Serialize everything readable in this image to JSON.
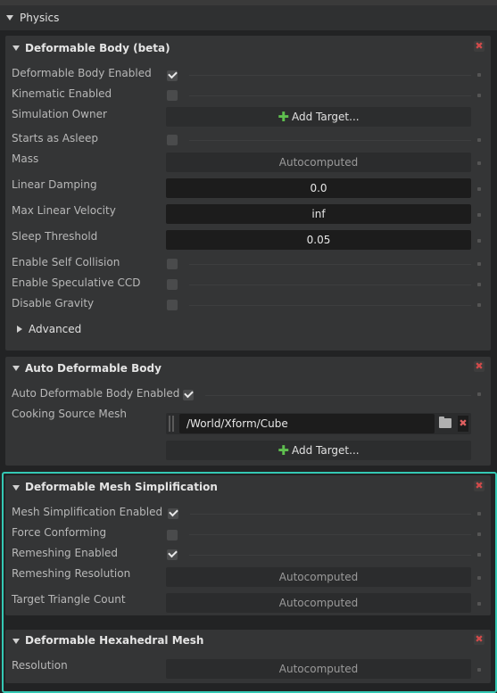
{
  "physics": {
    "title": "Physics"
  },
  "deformable_body": {
    "title": "Deformable Body (beta)",
    "rows": [
      {
        "label": "Deformable Body Enabled",
        "type": "checkbox",
        "checked": true
      },
      {
        "label": "Kinematic Enabled",
        "type": "checkbox",
        "checked": false
      },
      {
        "label": "Simulation Owner",
        "type": "add_target",
        "button_label": "Add Target..."
      },
      {
        "label": "Starts as Asleep",
        "type": "checkbox",
        "checked": false
      },
      {
        "label": "Mass",
        "type": "field",
        "value": "Autocomputed"
      },
      {
        "label": "Linear Damping",
        "type": "field_dark",
        "value": "0.0"
      },
      {
        "label": "Max Linear Velocity",
        "type": "field_dark",
        "value": "inf"
      },
      {
        "label": "Sleep Threshold",
        "type": "field_dark",
        "value": "0.05"
      },
      {
        "label": "Enable Self Collision",
        "type": "checkbox",
        "checked": false
      },
      {
        "label": "Enable Speculative CCD",
        "type": "checkbox",
        "checked": false
      },
      {
        "label": "Disable Gravity",
        "type": "checkbox",
        "checked": false
      }
    ],
    "advanced_label": "Advanced"
  },
  "auto_deformable": {
    "title": "Auto Deformable Body",
    "enabled_label": "Auto Deformable Body Enabled",
    "enabled_checked": true,
    "mesh_label": "Cooking Source Mesh",
    "mesh_path": "/World/Xform/Cube",
    "add_target_label": "Add Target..."
  },
  "mesh_simplification": {
    "title": "Deformable Mesh Simplification",
    "rows": [
      {
        "label": "Mesh Simplification Enabled",
        "type": "checkbox",
        "checked": true
      },
      {
        "label": "Force Conforming",
        "type": "checkbox",
        "checked": false
      },
      {
        "label": "Remeshing Enabled",
        "type": "checkbox",
        "checked": true
      },
      {
        "label": "Remeshing Resolution",
        "type": "field",
        "value": "Autocomputed"
      },
      {
        "label": "Target Triangle Count",
        "type": "field",
        "value": "Autocomputed"
      }
    ]
  },
  "hexahedral": {
    "title": "Deformable Hexahedral Mesh",
    "resolution_label": "Resolution",
    "resolution_value": "Autocomputed"
  },
  "icons": {
    "close": "close-icon",
    "folder": "folder-icon",
    "clear": "clear-icon",
    "plus": "plus-icon"
  },
  "colors": {
    "highlight": "#34c8b4",
    "close": "#d04a4a",
    "plus": "#5fbf4f"
  }
}
